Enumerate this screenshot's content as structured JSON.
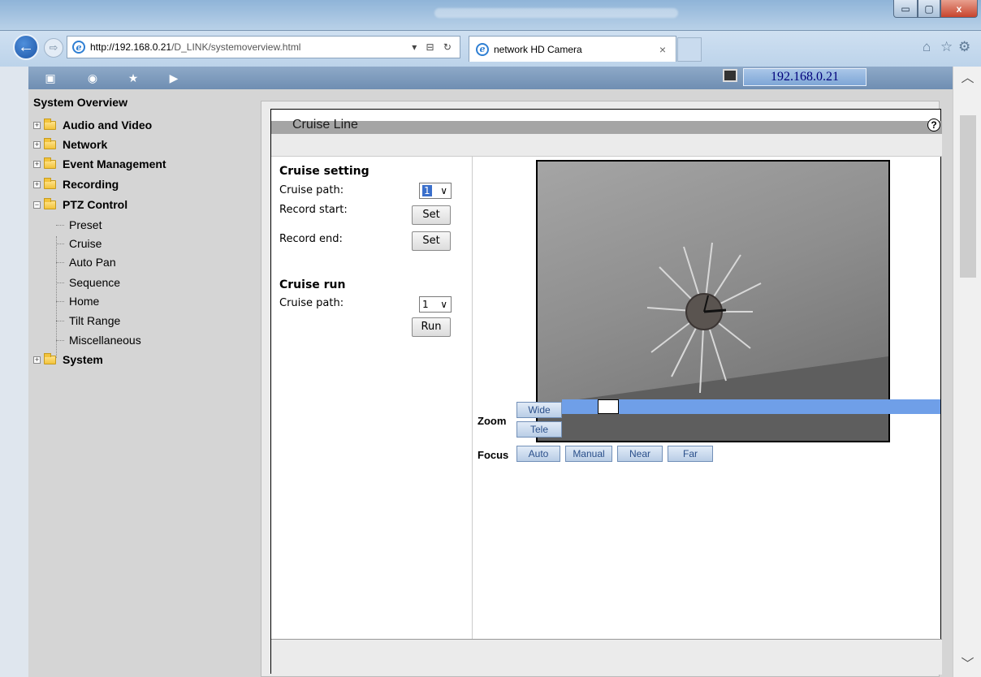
{
  "browser": {
    "url_host": "http://192.168.0.21",
    "url_path": "/D_LINK/systemoverview.html",
    "tab_title": "network HD Camera",
    "tab_close": "×",
    "window_buttons": {
      "minimize": "▭",
      "maximize": "▢",
      "close": "x"
    }
  },
  "toolbar": {
    "ip_address": "192.168.0.21"
  },
  "sidebar": {
    "title": "System Overview",
    "items": [
      {
        "label": "Audio and Video",
        "expanded": false
      },
      {
        "label": "Network",
        "expanded": false
      },
      {
        "label": "Event Management",
        "expanded": false
      },
      {
        "label": "Recording",
        "expanded": false
      },
      {
        "label": "PTZ Control",
        "expanded": true
      },
      {
        "label": "System",
        "expanded": false
      }
    ],
    "ptz_children": [
      "Preset",
      "Cruise",
      "Auto Pan",
      "Sequence",
      "Home",
      "Tilt Range",
      "Miscellaneous"
    ]
  },
  "panel": {
    "title": "Cruise Line",
    "help": "?",
    "cruise_setting": {
      "heading": "Cruise setting",
      "path_label": "Cruise path:",
      "path_value": "1",
      "record_start_label": "Record start:",
      "record_start_btn": "Set",
      "record_end_label": "Record end:",
      "record_end_btn": "Set"
    },
    "cruise_run": {
      "heading": "Cruise run",
      "path_label": "Cruise path:",
      "path_value": "1",
      "run_btn": "Run"
    },
    "ptz": {
      "zoom_label": "Zoom",
      "wide": "Wide",
      "tele": "Tele",
      "focus_label": "Focus",
      "auto": "Auto",
      "manual": "Manual",
      "near": "Near",
      "far": "Far",
      "zoom_level": 0.1
    }
  },
  "icons": {
    "back": "back-arrow-icon",
    "forward": "forward-arrow-icon",
    "home": "home-icon",
    "favorites": "star-icon",
    "settings": "gear-icon"
  }
}
